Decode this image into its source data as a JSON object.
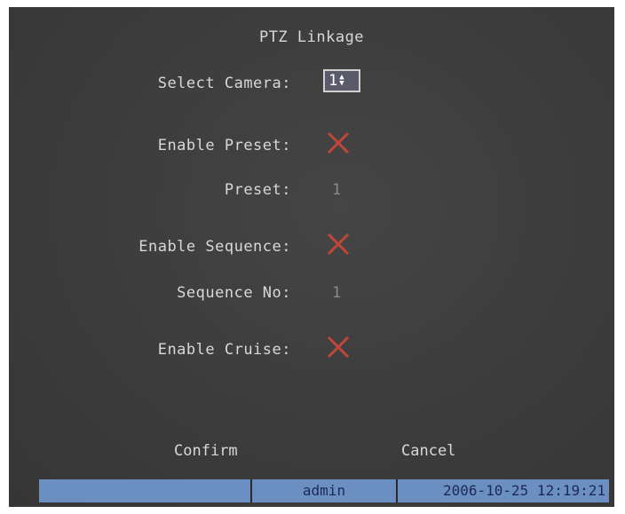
{
  "title": "PTZ Linkage",
  "fields": {
    "select_camera_label": "Select Camera:",
    "select_camera_value": "1",
    "enable_preset_label": "Enable Preset:",
    "preset_label": "Preset:",
    "preset_value": "1",
    "enable_sequence_label": "Enable Sequence:",
    "sequence_no_label": "Sequence No:",
    "sequence_no_value": "1",
    "enable_cruise_label": "Enable Cruise:",
    "enable_preset_state": "unchecked-x",
    "enable_sequence_state": "unchecked-x",
    "enable_cruise_state": "unchecked-x"
  },
  "buttons": {
    "confirm": "Confirm",
    "cancel": "Cancel"
  },
  "statusbar": {
    "left": "",
    "user": "admin",
    "datetime": "2006-10-25 12:19:21"
  },
  "colors": {
    "background": "#3d3d3d",
    "x_mark": "#c0463a",
    "statusbar": "#6a8fc0"
  },
  "icons": {
    "spin": "up-down-arrows-icon",
    "checkbox_off": "x-mark-icon"
  }
}
